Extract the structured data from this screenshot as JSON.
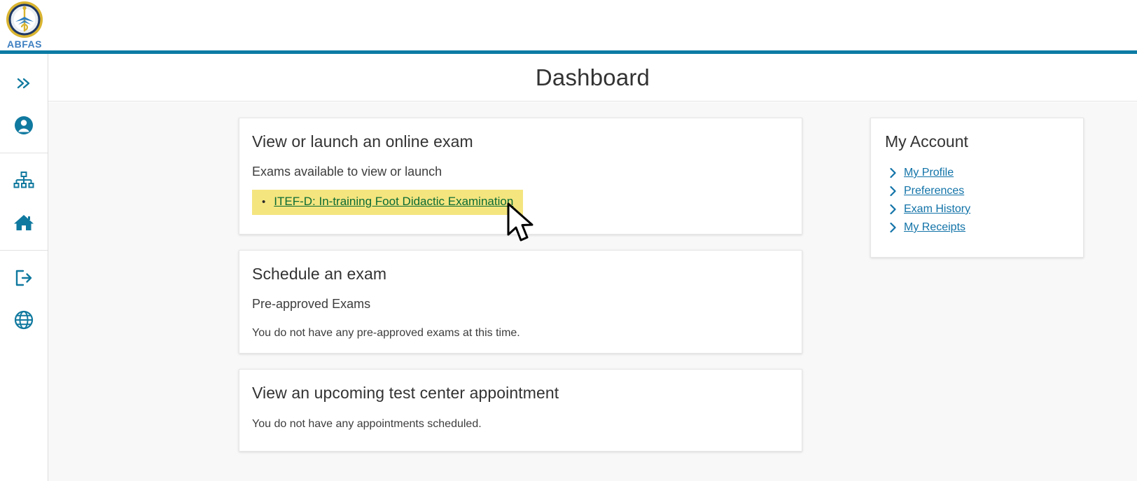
{
  "brand": {
    "wordmark": "ABFAS",
    "logo_icon": "abfas-seal-logo",
    "accent_color": "#0c7ba4",
    "seal_gold": "#d9b430",
    "seal_navy": "#1f3864",
    "wordmark_color": "#3e7fc1"
  },
  "sidebar": {
    "items": [
      {
        "icon": "double-chevron-right-icon",
        "name": "expand-menu"
      },
      {
        "icon": "user-account-icon",
        "name": "account"
      },
      {
        "icon": "sitemap-icon",
        "name": "organization"
      },
      {
        "icon": "home-icon",
        "name": "home"
      },
      {
        "icon": "logout-icon",
        "name": "logout"
      },
      {
        "icon": "globe-icon",
        "name": "language"
      }
    ],
    "icon_color": "#10799f"
  },
  "header": {
    "title": "Dashboard"
  },
  "cards": {
    "online_exam": {
      "title": "View or launch an online exam",
      "subtitle": "Exams available to view or launch",
      "exam_link": "ITEF-D: In-training Foot Didactic Examination",
      "highlight_color": "#f4e57f",
      "link_color": "#0b6b33"
    },
    "schedule_exam": {
      "title": "Schedule an exam",
      "subtitle": "Pre-approved Exams",
      "note": "You do not have any pre-approved exams at this time."
    },
    "test_center": {
      "title": "View an upcoming test center appointment",
      "note": "You do not have any appointments scheduled."
    }
  },
  "my_account": {
    "title": "My Account",
    "link_color": "#1273a8",
    "links": [
      {
        "label": "My Profile"
      },
      {
        "label": "Preferences"
      },
      {
        "label": "Exam History"
      },
      {
        "label": "My Receipts"
      }
    ]
  },
  "cursor": {
    "icon": "mouse-arrow-cursor"
  }
}
